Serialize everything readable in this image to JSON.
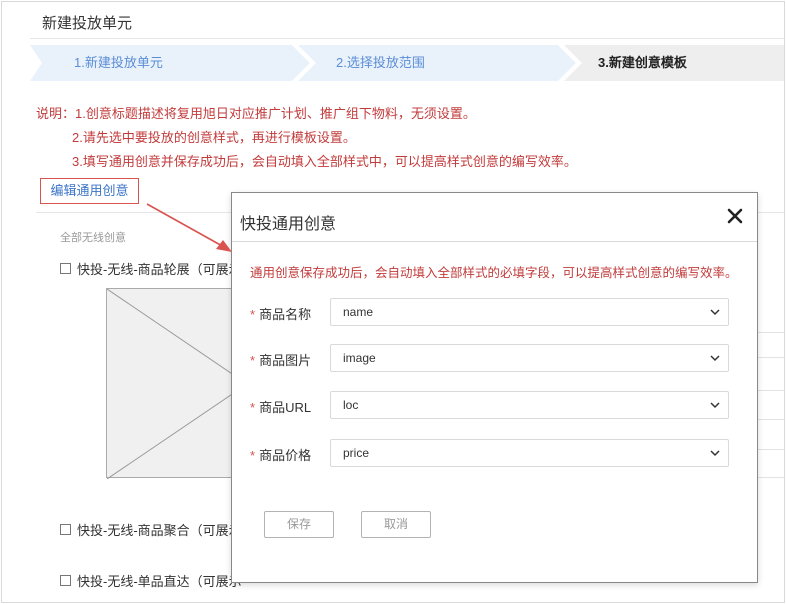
{
  "page": {
    "title": "新建投放单元"
  },
  "steps": [
    {
      "label": "1.新建投放单元"
    },
    {
      "label": "2.选择投放范围"
    },
    {
      "label": "3.新建创意模板"
    }
  ],
  "notes": {
    "prefix": "说明：",
    "items": [
      "1.创意标题描述将复用旭日对应推广计划、推广组下物料，无须设置。",
      "2.请先选中要投放的创意样式，再进行模板设置。",
      "3.填写通用创意并保存成功后，会自动填入全部样式中，可以提高样式创意的编写效率。"
    ]
  },
  "edit_link": "编辑通用创意",
  "creative_group": {
    "title": "全部无线创意",
    "items": [
      {
        "label": "快投-无线-商品轮展（可展示"
      },
      {
        "label": "快投-无线-商品聚合（可展示"
      },
      {
        "label": "快投-无线-单品直达（可展示"
      }
    ]
  },
  "modal": {
    "title": "快投通用创意",
    "tip": "通用创意保存成功后，会自动填入全部样式的必填字段，可以提高样式创意的编写效率。",
    "required_mark": "*",
    "fields": [
      {
        "label": "商品名称",
        "value": "name"
      },
      {
        "label": "商品图片",
        "value": "image"
      },
      {
        "label": "商品URL",
        "value": "loc"
      },
      {
        "label": "商品价格",
        "value": "price"
      }
    ],
    "save_label": "保存",
    "cancel_label": "取消"
  },
  "icons": {
    "close": "close-icon",
    "chevron": "chevron-down-icon",
    "checkbox": "checkbox-icon"
  },
  "colors": {
    "accent_red": "#c23b3b",
    "link_blue": "#3a74c7",
    "step_active_bg": "#e9f1fb",
    "step_text": "#5b8ed6"
  }
}
